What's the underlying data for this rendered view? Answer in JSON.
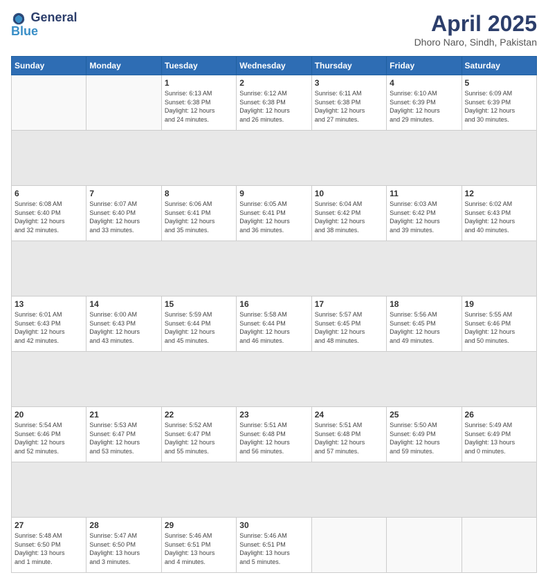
{
  "header": {
    "logo_line1": "General",
    "logo_line2": "Blue",
    "month_year": "April 2025",
    "location": "Dhoro Naro, Sindh, Pakistan"
  },
  "weekdays": [
    "Sunday",
    "Monday",
    "Tuesday",
    "Wednesday",
    "Thursday",
    "Friday",
    "Saturday"
  ],
  "weeks": [
    [
      {
        "day": "",
        "info": ""
      },
      {
        "day": "",
        "info": ""
      },
      {
        "day": "1",
        "info": "Sunrise: 6:13 AM\nSunset: 6:38 PM\nDaylight: 12 hours\nand 24 minutes."
      },
      {
        "day": "2",
        "info": "Sunrise: 6:12 AM\nSunset: 6:38 PM\nDaylight: 12 hours\nand 26 minutes."
      },
      {
        "day": "3",
        "info": "Sunrise: 6:11 AM\nSunset: 6:38 PM\nDaylight: 12 hours\nand 27 minutes."
      },
      {
        "day": "4",
        "info": "Sunrise: 6:10 AM\nSunset: 6:39 PM\nDaylight: 12 hours\nand 29 minutes."
      },
      {
        "day": "5",
        "info": "Sunrise: 6:09 AM\nSunset: 6:39 PM\nDaylight: 12 hours\nand 30 minutes."
      }
    ],
    [
      {
        "day": "6",
        "info": "Sunrise: 6:08 AM\nSunset: 6:40 PM\nDaylight: 12 hours\nand 32 minutes."
      },
      {
        "day": "7",
        "info": "Sunrise: 6:07 AM\nSunset: 6:40 PM\nDaylight: 12 hours\nand 33 minutes."
      },
      {
        "day": "8",
        "info": "Sunrise: 6:06 AM\nSunset: 6:41 PM\nDaylight: 12 hours\nand 35 minutes."
      },
      {
        "day": "9",
        "info": "Sunrise: 6:05 AM\nSunset: 6:41 PM\nDaylight: 12 hours\nand 36 minutes."
      },
      {
        "day": "10",
        "info": "Sunrise: 6:04 AM\nSunset: 6:42 PM\nDaylight: 12 hours\nand 38 minutes."
      },
      {
        "day": "11",
        "info": "Sunrise: 6:03 AM\nSunset: 6:42 PM\nDaylight: 12 hours\nand 39 minutes."
      },
      {
        "day": "12",
        "info": "Sunrise: 6:02 AM\nSunset: 6:43 PM\nDaylight: 12 hours\nand 40 minutes."
      }
    ],
    [
      {
        "day": "13",
        "info": "Sunrise: 6:01 AM\nSunset: 6:43 PM\nDaylight: 12 hours\nand 42 minutes."
      },
      {
        "day": "14",
        "info": "Sunrise: 6:00 AM\nSunset: 6:43 PM\nDaylight: 12 hours\nand 43 minutes."
      },
      {
        "day": "15",
        "info": "Sunrise: 5:59 AM\nSunset: 6:44 PM\nDaylight: 12 hours\nand 45 minutes."
      },
      {
        "day": "16",
        "info": "Sunrise: 5:58 AM\nSunset: 6:44 PM\nDaylight: 12 hours\nand 46 minutes."
      },
      {
        "day": "17",
        "info": "Sunrise: 5:57 AM\nSunset: 6:45 PM\nDaylight: 12 hours\nand 48 minutes."
      },
      {
        "day": "18",
        "info": "Sunrise: 5:56 AM\nSunset: 6:45 PM\nDaylight: 12 hours\nand 49 minutes."
      },
      {
        "day": "19",
        "info": "Sunrise: 5:55 AM\nSunset: 6:46 PM\nDaylight: 12 hours\nand 50 minutes."
      }
    ],
    [
      {
        "day": "20",
        "info": "Sunrise: 5:54 AM\nSunset: 6:46 PM\nDaylight: 12 hours\nand 52 minutes."
      },
      {
        "day": "21",
        "info": "Sunrise: 5:53 AM\nSunset: 6:47 PM\nDaylight: 12 hours\nand 53 minutes."
      },
      {
        "day": "22",
        "info": "Sunrise: 5:52 AM\nSunset: 6:47 PM\nDaylight: 12 hours\nand 55 minutes."
      },
      {
        "day": "23",
        "info": "Sunrise: 5:51 AM\nSunset: 6:48 PM\nDaylight: 12 hours\nand 56 minutes."
      },
      {
        "day": "24",
        "info": "Sunrise: 5:51 AM\nSunset: 6:48 PM\nDaylight: 12 hours\nand 57 minutes."
      },
      {
        "day": "25",
        "info": "Sunrise: 5:50 AM\nSunset: 6:49 PM\nDaylight: 12 hours\nand 59 minutes."
      },
      {
        "day": "26",
        "info": "Sunrise: 5:49 AM\nSunset: 6:49 PM\nDaylight: 13 hours\nand 0 minutes."
      }
    ],
    [
      {
        "day": "27",
        "info": "Sunrise: 5:48 AM\nSunset: 6:50 PM\nDaylight: 13 hours\nand 1 minute."
      },
      {
        "day": "28",
        "info": "Sunrise: 5:47 AM\nSunset: 6:50 PM\nDaylight: 13 hours\nand 3 minutes."
      },
      {
        "day": "29",
        "info": "Sunrise: 5:46 AM\nSunset: 6:51 PM\nDaylight: 13 hours\nand 4 minutes."
      },
      {
        "day": "30",
        "info": "Sunrise: 5:46 AM\nSunset: 6:51 PM\nDaylight: 13 hours\nand 5 minutes."
      },
      {
        "day": "",
        "info": ""
      },
      {
        "day": "",
        "info": ""
      },
      {
        "day": "",
        "info": ""
      }
    ]
  ]
}
